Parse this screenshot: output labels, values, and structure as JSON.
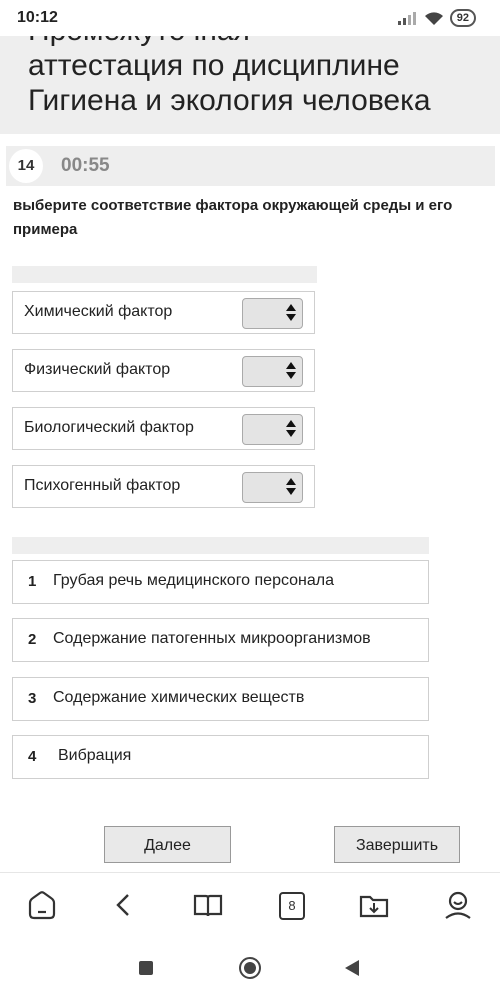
{
  "status_bar": {
    "time": "10:12",
    "battery": "92"
  },
  "header": {
    "title_partial": "Промежуточная",
    "title_line2": "аттестация по дисциплине",
    "title_line3": "Гигиена и экология человека"
  },
  "question": {
    "number": "14",
    "timer": "00:55",
    "text": "выберите соответствие фактора окружающей среды и его примера"
  },
  "matches": [
    {
      "label": "Химический фактор"
    },
    {
      "label": "Физический фактор"
    },
    {
      "label": "Биологический фактор"
    },
    {
      "label": "Психогенный фактор"
    }
  ],
  "options": [
    {
      "num": "1",
      "text": "Грубая речь медицинского персонала"
    },
    {
      "num": "2",
      "text": "Содержание патогенных микроорганизмов"
    },
    {
      "num": "3",
      "text": "Содержание химических веществ"
    },
    {
      "num": "4",
      "text": "Вибрация"
    }
  ],
  "buttons": {
    "next": "Далее",
    "finish": "Завершить"
  },
  "toolbar": {
    "tabs_count": "8"
  }
}
